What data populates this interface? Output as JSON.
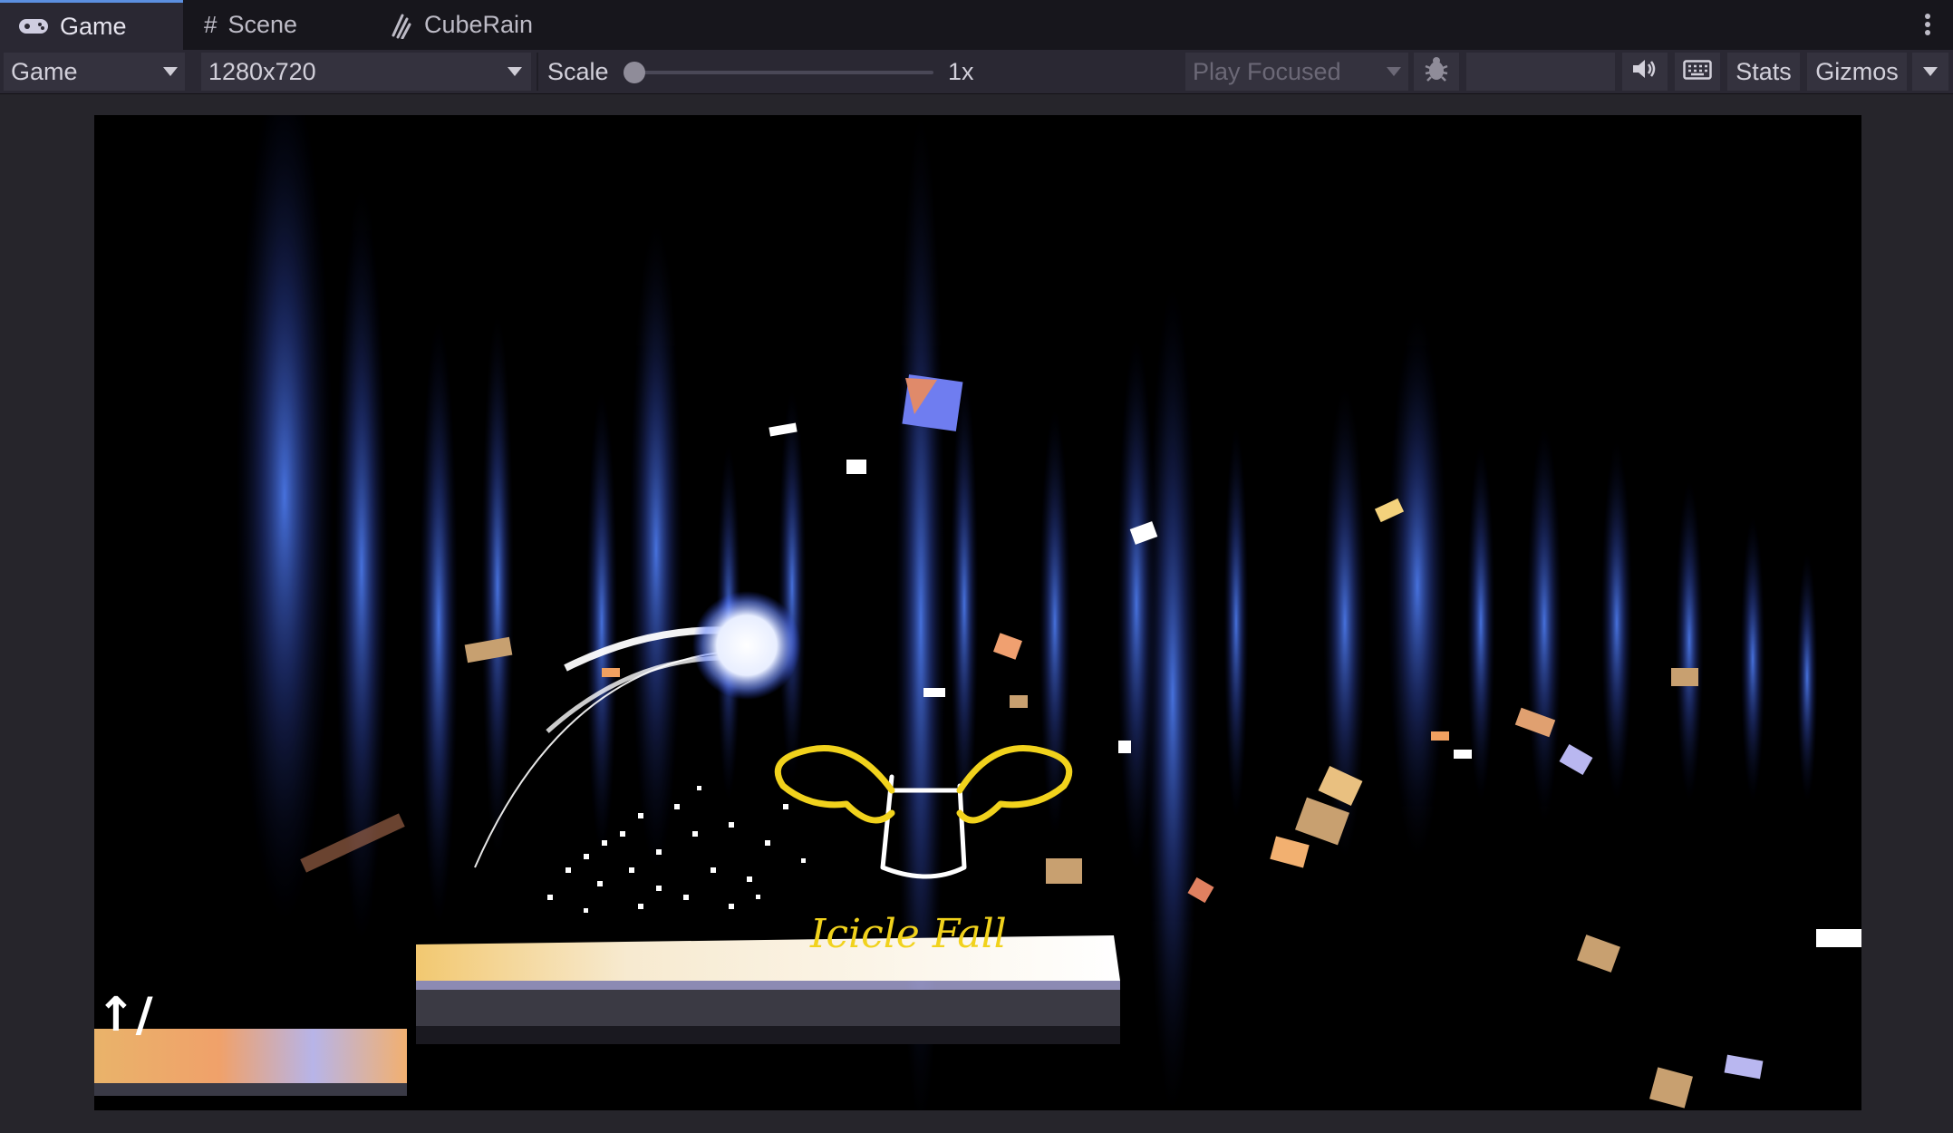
{
  "tabs": [
    {
      "label": "Game",
      "icon": "gamepad-icon",
      "active": true
    },
    {
      "label": "Scene",
      "icon": "grid-icon",
      "active": false
    },
    {
      "label": "CubeRain",
      "icon": "rain-icon",
      "active": false
    }
  ],
  "toolbar": {
    "display_select": "Game",
    "resolution_select": "1280x720",
    "scale_label": "Scale",
    "scale_value": "1x",
    "play_mode_select": "Play Focused",
    "stats_label": "Stats",
    "gizmos_label": "Gizmos"
  },
  "game_view": {
    "caption": "Icicle Fall",
    "corner_mark": "↑/"
  },
  "colors": {
    "accent": "#5b8fe0",
    "wings": "#f1d21c",
    "pillar_blue": "#3f6fe0",
    "platform": "#f3efe0"
  }
}
